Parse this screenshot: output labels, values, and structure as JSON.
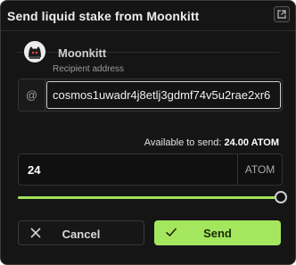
{
  "dialog": {
    "title": "Send liquid stake from Moonkitt"
  },
  "wallet": {
    "name": "Moonkitt"
  },
  "recipient": {
    "label": "Recipient address",
    "at_symbol": "@",
    "value": "cosmos1uwadr4j8etlj3gdmf74v5u2rae2xr6"
  },
  "amount": {
    "available_label": "Available to send:",
    "available_value": "24.00 ATOM",
    "value": "24",
    "unit": "ATOM",
    "slider_fraction": 1.0
  },
  "actions": {
    "cancel_label": "Cancel",
    "send_label": "Send"
  },
  "colors": {
    "accent": "#a5e65f",
    "background": "#151515"
  },
  "icons": {
    "titlebar": "external-link-icon",
    "cancel": "close-icon",
    "send": "check-icon"
  }
}
